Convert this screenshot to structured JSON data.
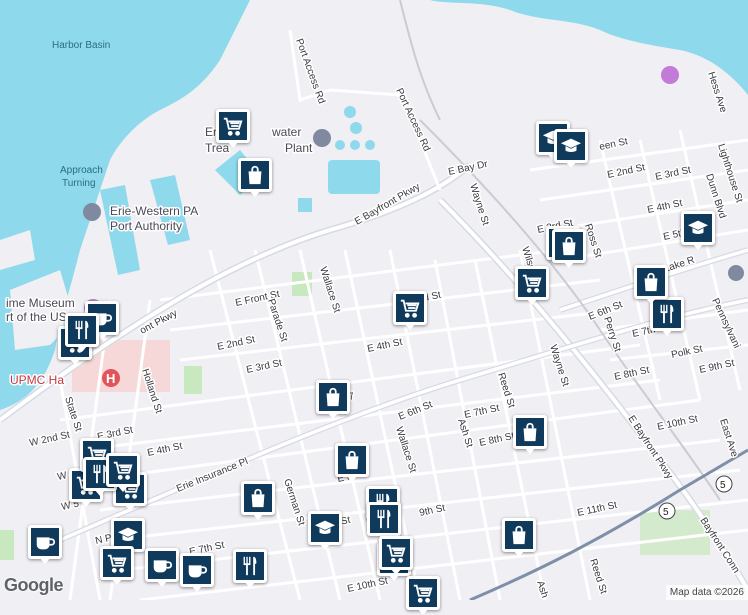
{
  "colors": {
    "water": "#8fd9ec",
    "land": "#f0eff4",
    "park": "#c8e8c0",
    "road": "#ffffff",
    "highway": "#d6dbe3",
    "hospital_area": "#f6d8d8",
    "marker_fill": "#0f3a5c",
    "marker_border": "#ffffff"
  },
  "water_labels": {
    "harbor_basin": "Harbor Basin",
    "approach_1": "Approach",
    "approach_2": "Turning"
  },
  "poi_labels": {
    "water_plant_1": "Erie",
    "water_plant_2": "water",
    "water_plant_3": "Trea",
    "water_plant_4": "Plant",
    "port_authority_1": "Erie-Western PA",
    "port_authority_2": "Port Authority",
    "museum_1": "ime Museum",
    "museum_2": "rt of the US...",
    "hospital": "UPMC Ha"
  },
  "street_labels": {
    "port_access_rd_1": "Port Access Rd",
    "port_access_rd_2": "Port Access Rd",
    "e_bay_dr": "E Bay Dr",
    "e_bayfront_pkwy_1": "E Bayfront Pkwy",
    "e_bayfront_pkwy_2": "E Bayfront Pkwy",
    "bayfront_pkwy_w": "ont Pkwy",
    "bayfront_conn": "Bayfront Conn",
    "wayne_st_1": "Wayne St",
    "wayne_st_2": "Wayne St",
    "wilson": "Wilson",
    "ross_st": "Ross St",
    "perry_st": "Perry St",
    "e_3rd_st_1": "E 3rd St",
    "e_3rd_st_2": "E 3rd St",
    "e_3rd_st_3": "E 3rd St",
    "e_3rd_st_4": "E 3rd St",
    "e_4th_st_1": "E 4th St",
    "e_4th_st_2": "E 4th St",
    "e_4th_st_3": "E 4th St",
    "e_5th_st": "E 5th St",
    "e_6th_st_1": "E 6th St",
    "e_6th_st_2": "E 6th St",
    "e_7th_st_1": "E 7th St",
    "e_7th_st_2": "E 7th",
    "e_7th_st_3": "E 7th St",
    "e_8th_st_1": "E 8th St",
    "e_8th_st_2": "E 8th St",
    "e_8th_st_3": "E 8th St",
    "e_9th_st_1": "E 9th St",
    "e_9th_st_2": "9th St",
    "e_10th_st_1": "E 10th St",
    "e_10th_st_2": "E 10th St",
    "e_11th_st": "E 11th St",
    "e_2nd_st_1": "E 2nd St",
    "e_2nd_st_2": "E 2nd St",
    "green_st": "een St",
    "e_front_st": "E Front St",
    "e_lake_rd": "E Lake R",
    "wallace_st_1": "Wallace St",
    "wallace_st_2": "Wallace St",
    "parade_st": "Parade St",
    "holland_st": "Holland St",
    "state_st": "State St",
    "w_2nd_st": "W 2nd St",
    "e_3rd_st_w": "E 3rd St",
    "e_4th_st_w": "E 4th St",
    "w4": "W 4",
    "ws": "W 5",
    "n_park": "N Park",
    "german_st": "German St",
    "erie_insurance_pl": "Erie Insurance Pl",
    "reed_st_1": "Reed St",
    "reed_st_2": "Reed St",
    "ash_st_1": "Ash St",
    "ash_st_2": "Ash",
    "polk_st": "Polk St",
    "pennsylvania": "Pennsylvani",
    "lighthouse_st": "Lighthouse St",
    "dunn_blvd": "Dunn Blvd",
    "hess_ave": "Hess Ave",
    "east_ave": "East Ave",
    "ef": "E F",
    "e7": "E 7",
    "route_5a": "5",
    "route_5b": "5"
  },
  "markers": [
    {
      "type": "shopping-cart",
      "icon": "cart"
    },
    {
      "type": "shopping-bag",
      "icon": "bag"
    },
    {
      "type": "school",
      "icon": "cap"
    },
    {
      "type": "school",
      "icon": "cap"
    },
    {
      "type": "shopping-bag",
      "icon": "bag"
    },
    {
      "type": "shopping-bag",
      "icon": "bag"
    },
    {
      "type": "school",
      "icon": "cap"
    },
    {
      "type": "shopping-cart",
      "icon": "cart"
    },
    {
      "type": "shopping-bag",
      "icon": "bag"
    },
    {
      "type": "restaurant",
      "icon": "fork"
    },
    {
      "type": "shopping-cart",
      "icon": "cart"
    },
    {
      "type": "cafe",
      "icon": "cup"
    },
    {
      "type": "restaurant",
      "icon": "fork"
    },
    {
      "type": "shopping-cart",
      "icon": "cart"
    },
    {
      "type": "shopping-bag",
      "icon": "bag"
    },
    {
      "type": "shopping-bag",
      "icon": "bag"
    },
    {
      "type": "shopping-bag",
      "icon": "bag"
    },
    {
      "type": "shopping-cart",
      "icon": "cart"
    },
    {
      "type": "shopping-cart",
      "icon": "cart"
    },
    {
      "type": "shopping-cart",
      "icon": "cart"
    },
    {
      "type": "restaurant",
      "icon": "fork"
    },
    {
      "type": "shopping-bag",
      "icon": "bag"
    },
    {
      "type": "school",
      "icon": "cap"
    },
    {
      "type": "restaurant",
      "icon": "fork"
    },
    {
      "type": "shopping-cart",
      "icon": "cart"
    },
    {
      "type": "restaurant",
      "icon": "fork"
    },
    {
      "type": "shopping-bag",
      "icon": "bag"
    },
    {
      "type": "cafe",
      "icon": "cup"
    },
    {
      "type": "school",
      "icon": "cap"
    },
    {
      "type": "shopping-cart",
      "icon": "cart"
    },
    {
      "type": "cafe",
      "icon": "cup"
    },
    {
      "type": "cafe",
      "icon": "cup"
    },
    {
      "type": "restaurant",
      "icon": "fork"
    },
    {
      "type": "shopping-cart",
      "icon": "cart"
    },
    {
      "type": "restaurant",
      "icon": "fork"
    },
    {
      "type": "shopping-cart",
      "icon": "cart"
    }
  ],
  "footer": {
    "logo": "Google",
    "attribution": "Map data ©2026"
  }
}
